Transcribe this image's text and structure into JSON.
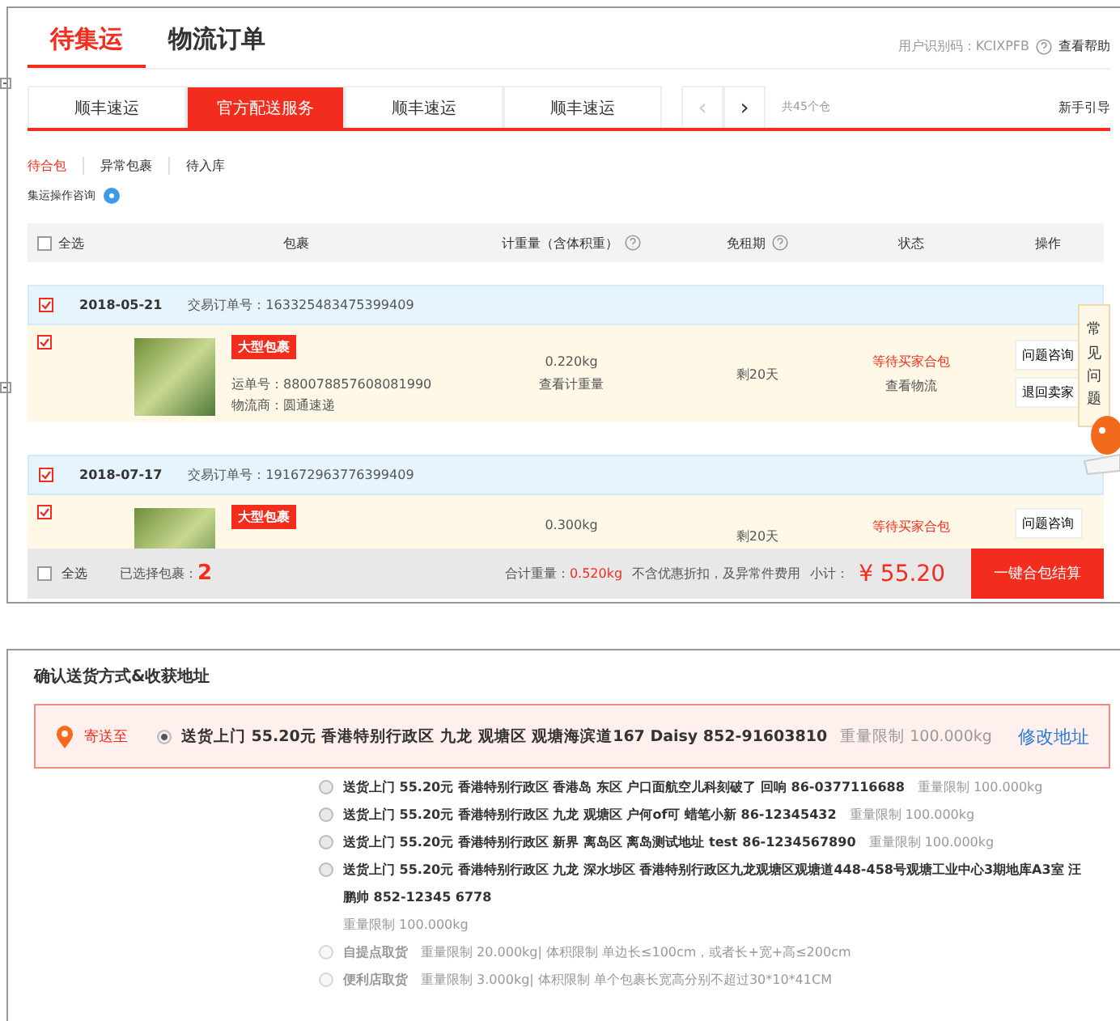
{
  "top": {
    "main_tabs": [
      {
        "label": "待集运",
        "selected": true
      },
      {
        "label": "物流订单",
        "selected": false
      }
    ],
    "user_id": "用户识别码：KCIXPFB",
    "help_link": "查看帮助",
    "carriers": [
      {
        "label": "顺丰速运",
        "selected": false
      },
      {
        "label": "官方配送服务",
        "selected": true
      },
      {
        "label": "顺丰速运",
        "selected": false
      },
      {
        "label": "顺丰速运",
        "selected": false
      }
    ],
    "pager": {
      "prev": "‹",
      "next": "›",
      "prev_disabled": true,
      "next_disabled": false
    },
    "warehouse_count": "共45个仓",
    "guide_link": "新手引导",
    "sub_tabs": [
      {
        "label": "待合包",
        "selected": true
      },
      {
        "label": "异常包裹",
        "selected": false
      },
      {
        "label": "待入库",
        "selected": false
      }
    ],
    "consult": "集运操作咨询",
    "select_all": {
      "label": "全选",
      "checked": false
    },
    "columns": [
      {
        "label": "包裹",
        "help": false
      },
      {
        "label": "计重量（含体积重）",
        "help": true
      },
      {
        "label": "免租期",
        "help": true
      },
      {
        "label": "状态",
        "help": false
      },
      {
        "label": "操作",
        "help": false
      }
    ],
    "orders": [
      {
        "checked": true,
        "date": "2018-05-21",
        "order_no": "交易订单号：163325483475399409",
        "items": [
          {
            "checked": true,
            "badge": "大型包裹",
            "waybill": "运单号：880078857608081990",
            "carrier": "物流商：圆通速递",
            "weight": "0.220kg",
            "weight_link": "查看计重量",
            "free_period": "剩20天",
            "status": "等待买家合包",
            "status_link": "查看物流",
            "actions": [
              "问题咨询",
              "退回卖家"
            ]
          }
        ]
      },
      {
        "checked": true,
        "date": "2018-07-17",
        "order_no": "交易订单号：191672963776399409",
        "items": [
          {
            "checked": true,
            "badge": "大型包裹",
            "weight": "0.300kg",
            "free_period": "剩20天",
            "status": "等待买家合包",
            "actions": [
              "问题咨询"
            ]
          }
        ]
      }
    ],
    "footer": {
      "select_all": {
        "label": "全选",
        "checked": false
      },
      "selected_label": "已选择包裹：",
      "selected_count": "2",
      "total_label": "合计重量：",
      "total_weight": "0.520kg",
      "note": "不含优惠折扣，及异常件费用",
      "subtotal_label": "小计：",
      "subtotal": "¥ 55.20",
      "checkout": "一键合包结算"
    },
    "faq_tab": "常见问题"
  },
  "address": {
    "title": "确认送货方式&收获地址",
    "ship_to": "寄送至",
    "change_link": "修改地址",
    "options": [
      {
        "selected": true,
        "disabled": false,
        "text": "送货上门  55.20元  香港特别行政区  九龙  观塘区  观塘海滨道167  Daisy  852-91603810",
        "limit": "重量限制 100.000kg"
      },
      {
        "selected": false,
        "disabled": false,
        "text": "送货上门  55.20元  香港特别行政区  香港岛  东区  户口面航空儿科刻破了  回响  86-0377116688",
        "limit": "重量限制 100.000kg"
      },
      {
        "selected": false,
        "disabled": false,
        "text": "送货上门  55.20元  香港特别行政区  九龙  观塘区  户何of可  蜡笔小新  86-12345432",
        "limit": "重量限制 100.000kg"
      },
      {
        "selected": false,
        "disabled": false,
        "text": "送货上门  55.20元  香港特别行政区  新界  离岛区  离岛测试地址  test  86-1234567890",
        "limit": "重量限制 100.000kg"
      },
      {
        "selected": false,
        "disabled": false,
        "text": "送货上门  55.20元  香港特别行政区  九龙  深水埗区  香港特别行政区九龙观塘区观塘道448-458号观塘工业中心3期地库A3室  汪鹏帅  852-12345 6778",
        "limit": "重量限制 100.000kg"
      },
      {
        "selected": false,
        "disabled": true,
        "text": "自提点取货",
        "limit": "重量限制 20.000kg| 体积限制 单边长≤100cm，或者长+宽+高≤200cm"
      },
      {
        "selected": false,
        "disabled": true,
        "text": "便利店取货",
        "limit": "重量限制 3.000kg| 体积限制 单个包裹长宽高分别不超过30*10*41CM"
      }
    ]
  }
}
